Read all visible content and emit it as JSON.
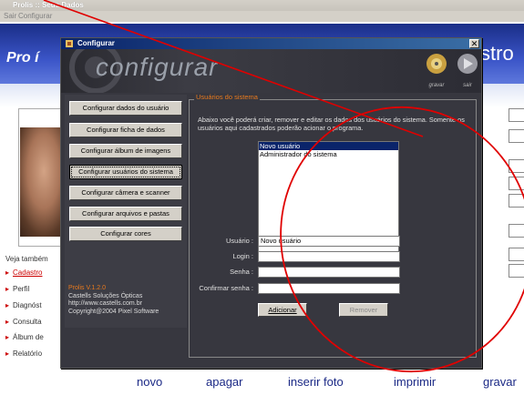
{
  "app": {
    "title": "Prolis :: Seus Dados",
    "menu": [
      "Sair",
      "Configurar"
    ],
    "logo_text": "Pro í",
    "banner_right_text": "stro",
    "veja_tambem": "Veja também",
    "side_links": [
      "Cadastro",
      "Perfil",
      "Diagnóst",
      "Consulta",
      "Álbum de",
      "Relatório"
    ],
    "bottom_actions": [
      "novo",
      "apagar",
      "inserir foto",
      "imprimir",
      "gravar"
    ]
  },
  "dialog": {
    "title": "Configurar",
    "close_glyph": "✕",
    "heading": "configurar",
    "gravar_label": "gravar",
    "sair_label": "sair",
    "menu_buttons": [
      "Configurar dados do usuário",
      "Configurar ficha de dados",
      "Configurar álbum de imagens",
      "Configurar usuários do sistema",
      "Configurar câmera e scanner",
      "Configurar arquivos e pastas",
      "Configurar cores"
    ],
    "active_menu": "Configurar usuários do sistema",
    "info": {
      "version": "Prolis V.1.2.0",
      "company": "Castells Soluções Ópticas",
      "url": "http://www.castells.com.br",
      "copyright": "Copyright@2004 Pixel Software"
    },
    "group": {
      "label": "Usuários do sistema",
      "description": "Abaixo você poderá criar, remover e editar os dados dos usuários do sistema. Somente os usuários aqui cadastrados poderão acionar o programa.",
      "users": [
        "Novo usuário",
        "Administrador do sistema"
      ],
      "selected_user": "Novo usuário",
      "fields": {
        "usuario_label": "Usuário :",
        "usuario_value": "Novo usuário",
        "login_label": "Login :",
        "login_value": "",
        "senha_label": "Senha :",
        "senha_value": "",
        "confirmar_label": "Confirmar senha :",
        "confirmar_value": ""
      },
      "adicionar_label": "Adicionar",
      "remover_label": "Remover"
    }
  },
  "colors": {
    "annotation": "#e00000",
    "accent_orange": "#e87a1e",
    "banner_blue": "#1a2e87"
  }
}
